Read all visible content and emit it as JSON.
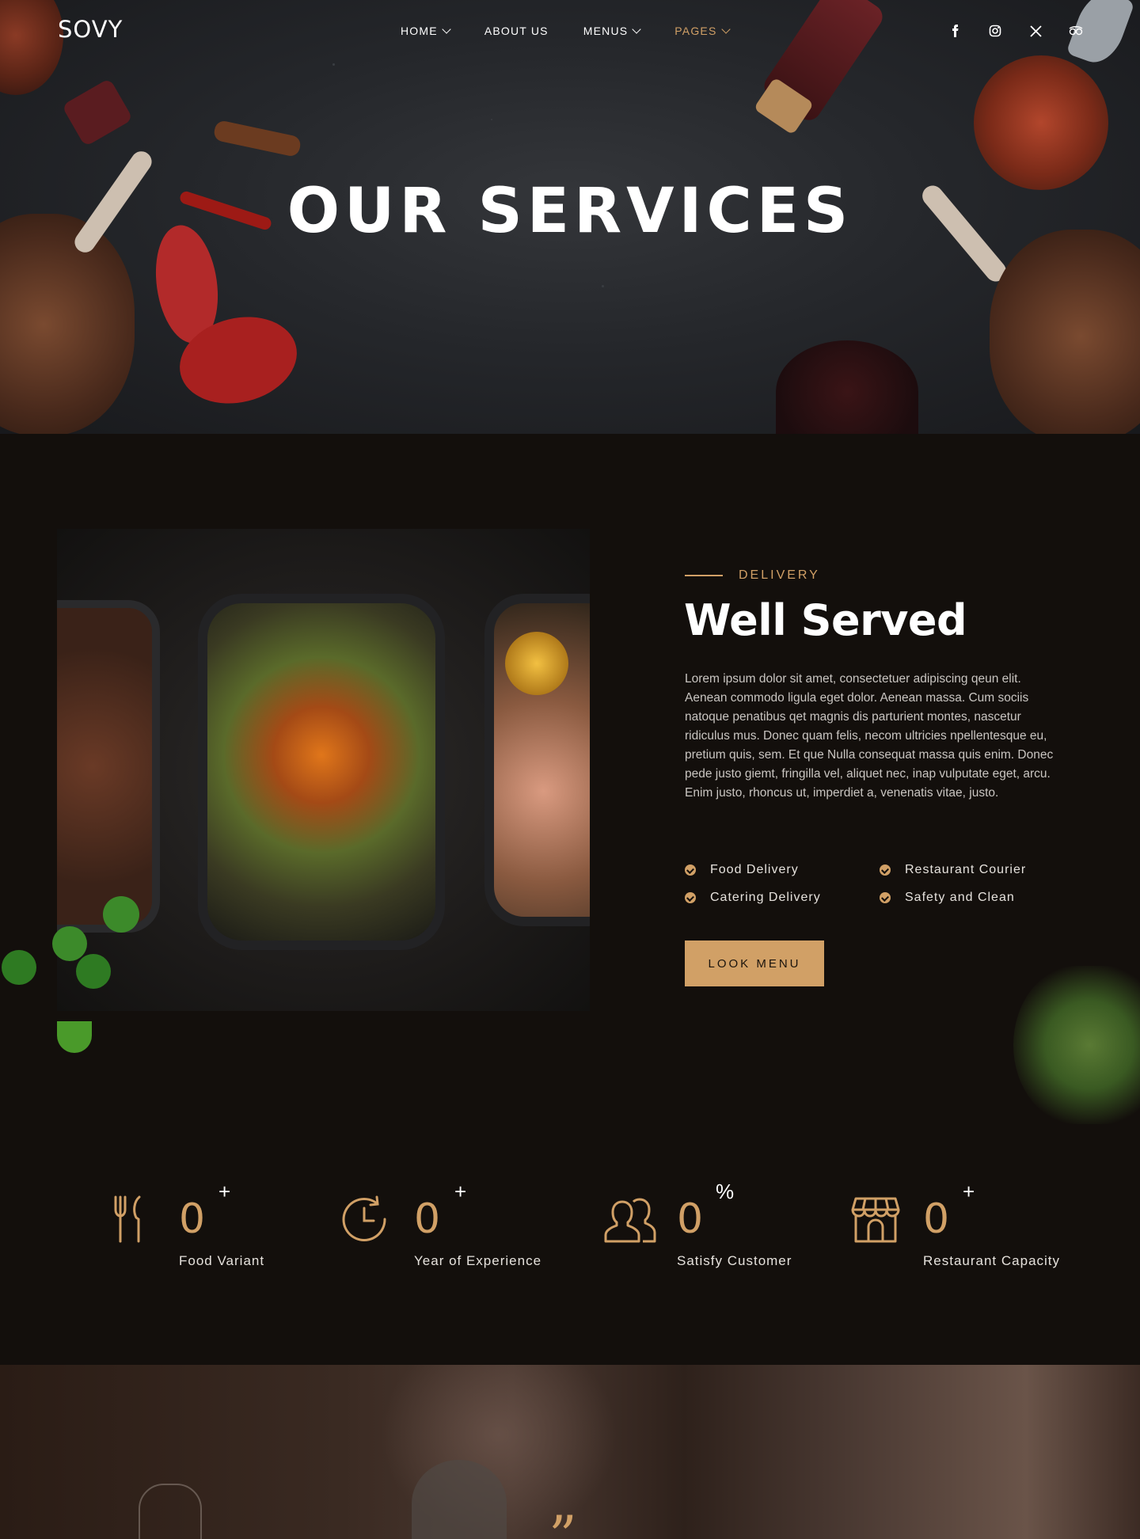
{
  "brand": {
    "logo": "SOVY",
    "accent": "#d1a066",
    "background": "#130f0c"
  },
  "nav": {
    "items": [
      {
        "label": "HOME",
        "dropdown": true,
        "active": false
      },
      {
        "label": "ABOUT US",
        "dropdown": false,
        "active": false
      },
      {
        "label": "MENUS",
        "dropdown": true,
        "active": false
      },
      {
        "label": "PAGES",
        "dropdown": true,
        "active": true
      }
    ],
    "social": [
      "facebook-icon",
      "instagram-icon",
      "x-icon",
      "tripadvisor-icon"
    ]
  },
  "hero": {
    "title": "OUR SERVICES"
  },
  "service": {
    "eyebrow": "DELIVERY",
    "title": "Well Served",
    "body": "Lorem ipsum dolor sit amet, consectetuer adipiscing qeun elit. Aenean commodo ligula eget dolor. Aenean massa. Cum sociis natoque penatibus qet magnis dis parturient montes, nascetur ridiculus mus. Donec quam felis, necom ultricies npellentesque eu, pretium quis, sem. Et que Nulla consequat massa quis enim. Donec pede justo giemt, fringilla vel, aliquet nec, inap vulputate eget, arcu. Enim justo, rhoncus ut, imperdiet a, venenatis vitae, justo.",
    "features": [
      "Food Delivery",
      "Restaurant Courier",
      "Catering Delivery",
      "Safety and Clean"
    ],
    "button": "LOOK MENU"
  },
  "stats": [
    {
      "icon": "utensils-icon",
      "value": "0",
      "suffix": "+",
      "label": "Food Variant"
    },
    {
      "icon": "clock-icon",
      "value": "0",
      "suffix": "+",
      "label": "Year of Experience"
    },
    {
      "icon": "users-icon",
      "value": "0",
      "suffix": "%",
      "label": "Satisfy Customer"
    },
    {
      "icon": "store-icon",
      "value": "0",
      "suffix": "+",
      "label": "Restaurant Capacity"
    }
  ],
  "testimonial": {
    "quote_mark": "”"
  }
}
